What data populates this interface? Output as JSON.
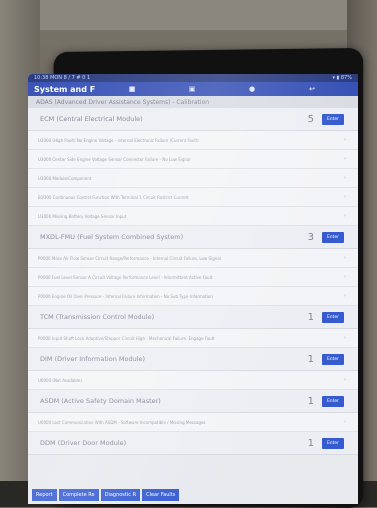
{
  "status_bar": {
    "left": "10:38 MON 8 / 7 # 0 1",
    "right": "▾ ▮ 87%"
  },
  "app_bar": {
    "title": "System and F",
    "icons": [
      "camera-icon",
      "screen-icon",
      "home-icon",
      "back-icon"
    ]
  },
  "sub_header": "ADAS (Advanced Driver Assistance Systems) - Calibration",
  "modules": [
    {
      "name": "ECM (Central Electrical Module)",
      "count": "5",
      "enter": "Enter",
      "dtcs": [
        "U3000 (High Fault) No Engine Voltage - Internal Electronic Failure (Current Fault)",
        "U3000 Center Side Engine Voltage Sensor Connector Failure - No Low Signal",
        "U3000 Module/Component",
        "B1D00 Continuous Control Function With Terminal 1 Circuit Restrict Current",
        "U3000 Missing Battery Voltage Sensor Input"
      ]
    },
    {
      "name": "MXDL-FMU (Fuel System Combined System)",
      "count": "3",
      "enter": "Enter",
      "dtcs": [
        "P0000 Mass Air Flow Sensor Circuit Range/Performance - Internal Circuit Failure, Low Signal",
        "P0000 Fuel Level Sensor A Circuit Voltage Performance Level - Intermittent Active Fault",
        "P0000 Engine Oil Over Pressure - Internal Failure Information - No Sub Type Information"
      ]
    },
    {
      "name": "TCM (Transmission Control Module)",
      "count": "1",
      "enter": "Enter",
      "dtcs": [
        "P0000 Input Shaft Lock Adaptive/Stepper Circuit High - Mechanical Failure, Engage Fault"
      ]
    },
    {
      "name": "DIM (Driver Information Module)",
      "count": "1",
      "enter": "Enter",
      "dtcs": [
        "U0000 (Not Available)"
      ]
    },
    {
      "name": "ASDM (Active Safety Domain Master)",
      "count": "1",
      "enter": "Enter",
      "dtcs": [
        "U0000 Lost Communication With ASDM - Software Incompatible / Missing Messages"
      ]
    },
    {
      "name": "DDM (Driver Door Module)",
      "count": "1",
      "enter": "Enter",
      "dtcs": []
    }
  ],
  "bottom_bar": {
    "buttons": [
      "Report",
      "Complete Re",
      "Diagnostic R",
      "Clear Faults"
    ]
  },
  "colors": {
    "app_bar": "#2f4bb3",
    "status_bar": "#22347a",
    "enter_button": "#2f56cf",
    "list_bg": "#eceef3"
  }
}
